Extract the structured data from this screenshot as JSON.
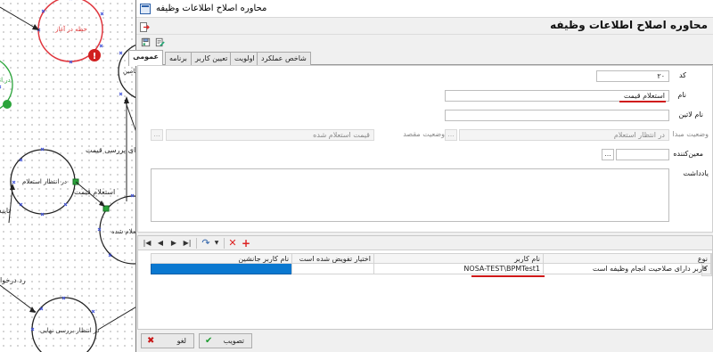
{
  "background": {
    "node_labels": {
      "start": "حظه در آغاز",
      "wait_confirm": "در انتظار استعلام",
      "inquiry": "استعلام شده",
      "final_review": "در انتظار بررسی نهایی",
      "top_right": "تامین",
      "left_green": "در اتا"
    },
    "edge_labels": {
      "price_review": "ای بررسی قیمت",
      "price_inquiry": "استعلام قیمت",
      "approve": "تایید",
      "reject": "رد درخوا"
    },
    "colors": {
      "node_red": "#e0373f",
      "node_black": "#222222",
      "accent_blue": "#3c4fd8",
      "green": "#2aa43a"
    }
  },
  "dialog": {
    "window_title": "محاوره اصلاح اطلاعات وظیفه",
    "heading": "محاوره اصلاح اطلاعات وظیفه",
    "tabs": [
      "عمومی",
      "برنامه",
      "تعیین کاربر",
      "اولویت",
      "شاخص عملکرد"
    ],
    "active_tab": "عمومی",
    "form": {
      "code_label": "کد",
      "code_value": "۲۰",
      "name_label": "نام",
      "name_value": "استعلام قیمت",
      "latin_name_label": "نام لاتین",
      "latin_name_value": "",
      "source_status_label": "وضعیت مبدا",
      "source_status_value": "در انتظار استعلام",
      "target_status_label": "وضعیت مقصد",
      "target_status_value": "قیمت استعلام شده",
      "assigner_label": "معین‌کننده",
      "assigner_value": "",
      "note_label": "یادداشت",
      "note_value": "",
      "ellipsis": "..."
    },
    "grid": {
      "columns": [
        "نوع",
        "نام کاربر",
        "اختیار تفویض شده است",
        "نام کاربر جانشین"
      ],
      "rows": [
        {
          "type": "کاربر دارای صلاحیت انجام وظیفه است",
          "user": "NOSA-TEST\\BPMTest1",
          "delegated": "",
          "substitute": ""
        }
      ],
      "row_marker": "*",
      "selection_color": "#0a78d0"
    },
    "buttons": {
      "ok": "تصویب",
      "cancel": "لغو"
    }
  }
}
